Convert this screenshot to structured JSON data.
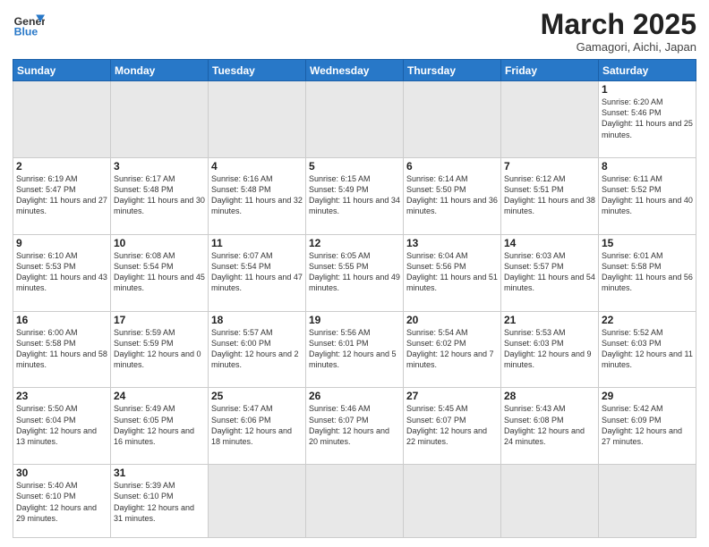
{
  "logo": {
    "line1": "General",
    "line2": "Blue"
  },
  "title": "March 2025",
  "subtitle": "Gamagori, Aichi, Japan",
  "weekdays": [
    "Sunday",
    "Monday",
    "Tuesday",
    "Wednesday",
    "Thursday",
    "Friday",
    "Saturday"
  ],
  "days": {
    "1": {
      "sunrise": "6:20 AM",
      "sunset": "5:46 PM",
      "daylight": "11 hours and 25 minutes."
    },
    "2": {
      "sunrise": "6:19 AM",
      "sunset": "5:47 PM",
      "daylight": "11 hours and 27 minutes."
    },
    "3": {
      "sunrise": "6:17 AM",
      "sunset": "5:48 PM",
      "daylight": "11 hours and 30 minutes."
    },
    "4": {
      "sunrise": "6:16 AM",
      "sunset": "5:48 PM",
      "daylight": "11 hours and 32 minutes."
    },
    "5": {
      "sunrise": "6:15 AM",
      "sunset": "5:49 PM",
      "daylight": "11 hours and 34 minutes."
    },
    "6": {
      "sunrise": "6:14 AM",
      "sunset": "5:50 PM",
      "daylight": "11 hours and 36 minutes."
    },
    "7": {
      "sunrise": "6:12 AM",
      "sunset": "5:51 PM",
      "daylight": "11 hours and 38 minutes."
    },
    "8": {
      "sunrise": "6:11 AM",
      "sunset": "5:52 PM",
      "daylight": "11 hours and 40 minutes."
    },
    "9": {
      "sunrise": "6:10 AM",
      "sunset": "5:53 PM",
      "daylight": "11 hours and 43 minutes."
    },
    "10": {
      "sunrise": "6:08 AM",
      "sunset": "5:54 PM",
      "daylight": "11 hours and 45 minutes."
    },
    "11": {
      "sunrise": "6:07 AM",
      "sunset": "5:54 PM",
      "daylight": "11 hours and 47 minutes."
    },
    "12": {
      "sunrise": "6:05 AM",
      "sunset": "5:55 PM",
      "daylight": "11 hours and 49 minutes."
    },
    "13": {
      "sunrise": "6:04 AM",
      "sunset": "5:56 PM",
      "daylight": "11 hours and 51 minutes."
    },
    "14": {
      "sunrise": "6:03 AM",
      "sunset": "5:57 PM",
      "daylight": "11 hours and 54 minutes."
    },
    "15": {
      "sunrise": "6:01 AM",
      "sunset": "5:58 PM",
      "daylight": "11 hours and 56 minutes."
    },
    "16": {
      "sunrise": "6:00 AM",
      "sunset": "5:58 PM",
      "daylight": "11 hours and 58 minutes."
    },
    "17": {
      "sunrise": "5:59 AM",
      "sunset": "5:59 PM",
      "daylight": "12 hours and 0 minutes."
    },
    "18": {
      "sunrise": "5:57 AM",
      "sunset": "6:00 PM",
      "daylight": "12 hours and 2 minutes."
    },
    "19": {
      "sunrise": "5:56 AM",
      "sunset": "6:01 PM",
      "daylight": "12 hours and 5 minutes."
    },
    "20": {
      "sunrise": "5:54 AM",
      "sunset": "6:02 PM",
      "daylight": "12 hours and 7 minutes."
    },
    "21": {
      "sunrise": "5:53 AM",
      "sunset": "6:03 PM",
      "daylight": "12 hours and 9 minutes."
    },
    "22": {
      "sunrise": "5:52 AM",
      "sunset": "6:03 PM",
      "daylight": "12 hours and 11 minutes."
    },
    "23": {
      "sunrise": "5:50 AM",
      "sunset": "6:04 PM",
      "daylight": "12 hours and 13 minutes."
    },
    "24": {
      "sunrise": "5:49 AM",
      "sunset": "6:05 PM",
      "daylight": "12 hours and 16 minutes."
    },
    "25": {
      "sunrise": "5:47 AM",
      "sunset": "6:06 PM",
      "daylight": "12 hours and 18 minutes."
    },
    "26": {
      "sunrise": "5:46 AM",
      "sunset": "6:07 PM",
      "daylight": "12 hours and 20 minutes."
    },
    "27": {
      "sunrise": "5:45 AM",
      "sunset": "6:07 PM",
      "daylight": "12 hours and 22 minutes."
    },
    "28": {
      "sunrise": "5:43 AM",
      "sunset": "6:08 PM",
      "daylight": "12 hours and 24 minutes."
    },
    "29": {
      "sunrise": "5:42 AM",
      "sunset": "6:09 PM",
      "daylight": "12 hours and 27 minutes."
    },
    "30": {
      "sunrise": "5:40 AM",
      "sunset": "6:10 PM",
      "daylight": "12 hours and 29 minutes."
    },
    "31": {
      "sunrise": "5:39 AM",
      "sunset": "6:10 PM",
      "daylight": "12 hours and 31 minutes."
    }
  }
}
